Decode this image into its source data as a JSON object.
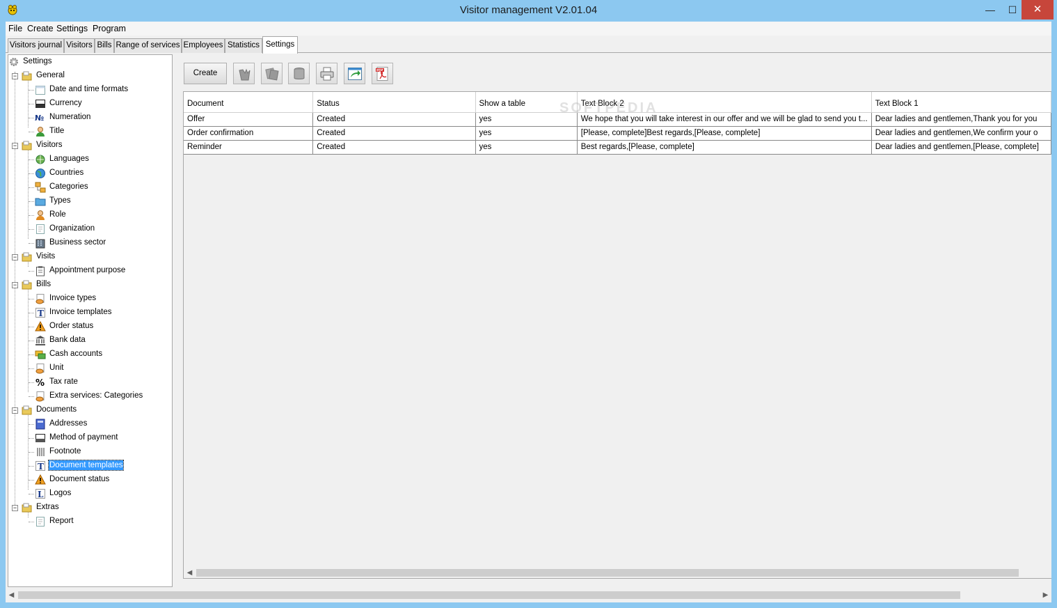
{
  "window": {
    "title": "Visitor management V2.01.04",
    "min": "—",
    "max": "☐",
    "close": "✕"
  },
  "menu": [
    "File",
    "Create",
    "Settings",
    "Program"
  ],
  "tabs": [
    "Visitors journal",
    "Visitors",
    "Bills",
    "Range of services",
    "Employees",
    "Statistics",
    "Settings"
  ],
  "active_tab": "Settings",
  "tree": {
    "root": "Settings",
    "groups": [
      {
        "label": "General",
        "items": [
          "Date and time formats",
          "Currency",
          "Numeration",
          "Title"
        ]
      },
      {
        "label": "Visitors",
        "items": [
          "Languages",
          "Countries",
          "Categories",
          "Types",
          "Role",
          "Organization",
          "Business sector"
        ]
      },
      {
        "label": "Visits",
        "items": [
          "Appointment purpose"
        ]
      },
      {
        "label": "Bills",
        "items": [
          "Invoice types",
          "Invoice templates",
          "Order status",
          "Bank data",
          "Cash accounts",
          "Unit",
          "Tax rate",
          "Extra services: Categories"
        ]
      },
      {
        "label": "Documents",
        "items": [
          "Addresses",
          "Method of payment",
          "Footnote",
          "Document templates",
          "Document status",
          "Logos"
        ]
      },
      {
        "label": "Extras",
        "items": [
          "Report"
        ]
      }
    ],
    "selected": "Document templates"
  },
  "toolbar": {
    "create_label": "Create"
  },
  "grid": {
    "columns": [
      "Document",
      "Status",
      "Show a table",
      "Text Block 2",
      "Text Block 1"
    ],
    "rows": [
      [
        "Offer",
        "Created",
        "yes",
        "We hope that you will take interest in our offer and we will be glad to send you t...",
        "Dear ladies and gentlemen,Thank you for you"
      ],
      [
        "Order confirmation",
        "Created",
        "yes",
        "[Please, complete]Best regards,[Please, complete]",
        "Dear ladies and gentlemen,We confirm your o"
      ],
      [
        "Reminder",
        "Created",
        "yes",
        "Best regards,[Please, complete]",
        "Dear ladies and gentlemen,[Please, complete]"
      ]
    ]
  },
  "watermark": "SOFTPEDIA"
}
